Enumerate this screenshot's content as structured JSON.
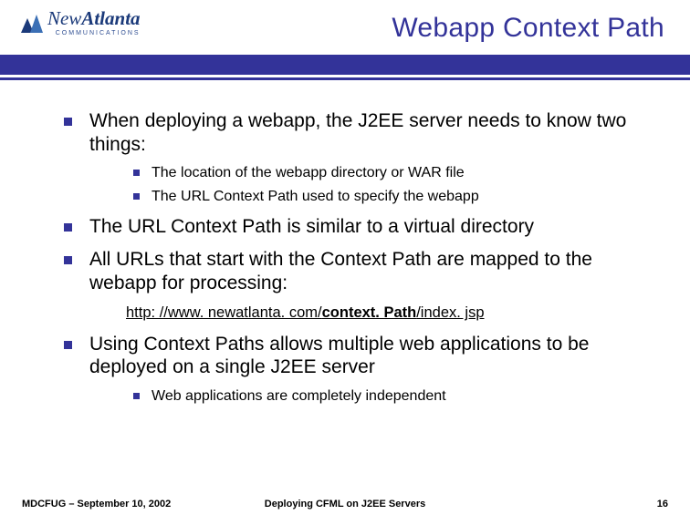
{
  "logo": {
    "name_prefix": "New",
    "name_bold": "Atlanta",
    "subtext": "COMMUNICATIONS"
  },
  "title": "Webapp Context Path",
  "bullets": {
    "p1": "When deploying a webapp, the J2EE server needs to know two things:",
    "p1_sub1": "The location of the webapp directory or WAR file",
    "p1_sub2": "The URL Context Path used to specify the webapp",
    "p2": "The URL Context Path is similar to a virtual directory",
    "p3": "All URLs that start with the Context Path are mapped to the webapp for processing:",
    "url_prefix": "http: //www. newatlanta. com/",
    "url_context": "context. Path",
    "url_suffix": "/index. jsp",
    "p4": "Using Context Paths allows multiple web applications to be deployed on a single J2EE server",
    "p4_sub1": "Web applications are completely independent"
  },
  "footer": {
    "left": "MDCFUG – September 10, 2002",
    "center": "Deploying CFML on J2EE Servers",
    "right": "16"
  },
  "colors": {
    "accent": "#333399"
  }
}
